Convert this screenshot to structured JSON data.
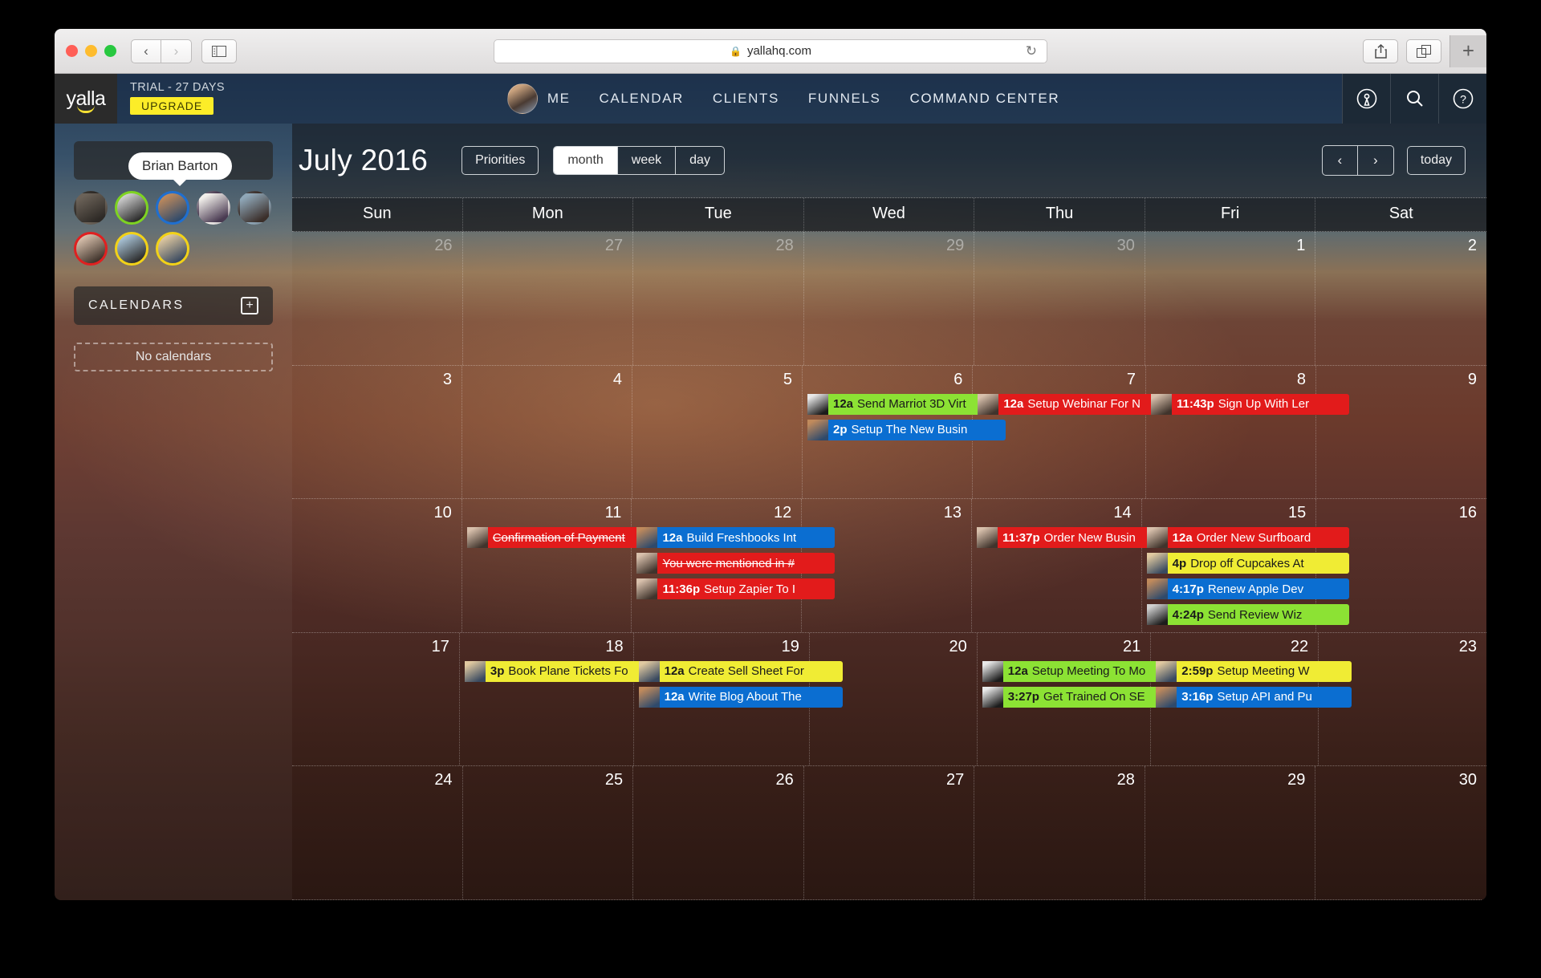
{
  "browser": {
    "url": "yallahq.com",
    "lock_icon": "lock-icon",
    "back_icon": "‹",
    "forward_icon": "›",
    "reload_icon": "↻",
    "newtab_label": "+"
  },
  "topnav": {
    "logo": "yalla",
    "trial_label": "TRIAL - 27 DAYS",
    "upgrade_label": "UPGRADE",
    "links": [
      {
        "label": "ME"
      },
      {
        "label": "CALENDAR"
      },
      {
        "label": "CLIENTS"
      },
      {
        "label": "FUNNELS"
      },
      {
        "label": "COMMAND CENTER"
      }
    ],
    "icons": [
      "broadcast-icon",
      "search-icon",
      "help-icon"
    ]
  },
  "sidebar": {
    "tooltip_name": "Brian Barton",
    "calendars_label": "CALENDARS",
    "add_calendar_icon": "plus-icon",
    "no_calendars_label": "No calendars",
    "avatars": [
      {
        "ring": "none",
        "c1": "#6b6258",
        "c2": "#2e2a26"
      },
      {
        "ring": "#7ed321",
        "c1": "#cfcfcf",
        "c2": "#2b2b2b"
      },
      {
        "ring": "#1f6fd0",
        "c1": "#c08a5c",
        "c2": "#2f4a6b"
      },
      {
        "ring": "none",
        "c1": "#f1eeea",
        "c2": "#4a3b52"
      },
      {
        "ring": "none",
        "c1": "#8fa7b8",
        "c2": "#3b2f2a"
      },
      {
        "ring": "#e02020",
        "c1": "#d8c0ac",
        "c2": "#40342c"
      },
      {
        "ring": "#f2d218",
        "c1": "#a9c3d6",
        "c2": "#2c2c2c"
      },
      {
        "ring": "#f2d218",
        "c1": "#e0c9a0",
        "c2": "#3a4a60"
      }
    ]
  },
  "calendar": {
    "title": "July 2016",
    "priorities_label": "Priorities",
    "views": [
      {
        "label": "month",
        "active": true
      },
      {
        "label": "week",
        "active": false
      },
      {
        "label": "day",
        "active": false
      }
    ],
    "prev_label": "‹",
    "next_label": "›",
    "today_label": "today",
    "daynames": [
      "Sun",
      "Mon",
      "Tue",
      "Wed",
      "Thu",
      "Fri",
      "Sat"
    ],
    "weeks": [
      {
        "days": [
          {
            "num": "26",
            "other": true,
            "events": []
          },
          {
            "num": "27",
            "other": true,
            "events": []
          },
          {
            "num": "28",
            "other": true,
            "events": []
          },
          {
            "num": "29",
            "other": true,
            "events": []
          },
          {
            "num": "30",
            "other": true,
            "events": []
          },
          {
            "num": "1",
            "other": false,
            "events": []
          },
          {
            "num": "2",
            "other": false,
            "events": []
          }
        ]
      },
      {
        "days": [
          {
            "num": "3",
            "other": false,
            "events": []
          },
          {
            "num": "4",
            "other": false,
            "events": []
          },
          {
            "num": "5",
            "other": false,
            "events": []
          },
          {
            "num": "6",
            "other": false,
            "events": [
              {
                "time": "12a",
                "title": "Send Marriot 3D Virt",
                "color": "#8ce234",
                "text": "#1a1a1a",
                "strike": false,
                "c1": "#e8e8e8",
                "c2": "#1c1c1c"
              },
              {
                "time": "2p",
                "title": "Setup The New Busin",
                "color": "#0b6ed1",
                "text": "#ffffff",
                "strike": false,
                "c1": "#c08a5c",
                "c2": "#2f4a6b"
              }
            ]
          },
          {
            "num": "7",
            "other": false,
            "events": [
              {
                "time": "12a",
                "title": "Setup Webinar For N",
                "color": "#e21b1b",
                "text": "#ffffff",
                "strike": false,
                "c1": "#d8c0ac",
                "c2": "#40342c"
              }
            ]
          },
          {
            "num": "8",
            "other": false,
            "events": [
              {
                "time": "11:43p",
                "title": "Sign Up With Ler",
                "color": "#e21b1b",
                "text": "#ffffff",
                "strike": false,
                "c1": "#d8c0ac",
                "c2": "#40342c"
              }
            ]
          },
          {
            "num": "9",
            "other": false,
            "events": []
          }
        ]
      },
      {
        "days": [
          {
            "num": "10",
            "other": false,
            "events": []
          },
          {
            "num": "11",
            "other": false,
            "events": [
              {
                "time": "",
                "title": "Confirmation of Payment",
                "color": "#e21b1b",
                "text": "#ffffff",
                "strike": true,
                "c1": "#d8c0ac",
                "c2": "#40342c"
              }
            ]
          },
          {
            "num": "12",
            "other": false,
            "events": [
              {
                "time": "12a",
                "title": "Build Freshbooks Int",
                "color": "#0b6ed1",
                "text": "#ffffff",
                "strike": false,
                "c1": "#c08a5c",
                "c2": "#2f4a6b"
              },
              {
                "time": "",
                "title": "You were mentioned in #",
                "color": "#e21b1b",
                "text": "#ffffff",
                "strike": true,
                "c1": "#d8c0ac",
                "c2": "#40342c"
              },
              {
                "time": "11:36p",
                "title": "Setup Zapier To I",
                "color": "#e21b1b",
                "text": "#ffffff",
                "strike": false,
                "c1": "#d8c0ac",
                "c2": "#40342c"
              }
            ]
          },
          {
            "num": "13",
            "other": false,
            "events": []
          },
          {
            "num": "14",
            "other": false,
            "events": [
              {
                "time": "11:37p",
                "title": "Order New Busin",
                "color": "#e21b1b",
                "text": "#ffffff",
                "strike": false,
                "c1": "#d8c0ac",
                "c2": "#40342c"
              }
            ]
          },
          {
            "num": "15",
            "other": false,
            "events": [
              {
                "time": "12a",
                "title": "Order New Surfboard",
                "color": "#e21b1b",
                "text": "#ffffff",
                "strike": false,
                "c1": "#d8c0ac",
                "c2": "#40342c"
              },
              {
                "time": "4p",
                "title": "Drop off Cupcakes At",
                "color": "#f0ec34",
                "text": "#1a1a1a",
                "strike": false,
                "c1": "#e0c9a0",
                "c2": "#3a4a60"
              },
              {
                "time": "4:17p",
                "title": "Renew Apple Dev",
                "color": "#0b6ed1",
                "text": "#ffffff",
                "strike": false,
                "c1": "#c08a5c",
                "c2": "#2f4a6b"
              },
              {
                "time": "4:24p",
                "title": "Send Review Wiz",
                "color": "#8ce234",
                "text": "#1a1a1a",
                "strike": false,
                "c1": "#d0d0d0",
                "c2": "#1c1c1c"
              }
            ]
          },
          {
            "num": "16",
            "other": false,
            "events": []
          }
        ]
      },
      {
        "days": [
          {
            "num": "17",
            "other": false,
            "events": []
          },
          {
            "num": "18",
            "other": false,
            "events": [
              {
                "time": "3p",
                "title": "Book Plane Tickets Fo",
                "color": "#f0ec34",
                "text": "#1a1a1a",
                "strike": false,
                "c1": "#e0c9a0",
                "c2": "#3a4a60"
              }
            ]
          },
          {
            "num": "19",
            "other": false,
            "events": [
              {
                "time": "12a",
                "title": "Create Sell Sheet For",
                "color": "#f0ec34",
                "text": "#1a1a1a",
                "strike": false,
                "c1": "#e0c9a0",
                "c2": "#3a4a60"
              },
              {
                "time": "12a",
                "title": "Write Blog About The",
                "color": "#0b6ed1",
                "text": "#ffffff",
                "strike": false,
                "c1": "#c08a5c",
                "c2": "#2f4a6b"
              }
            ]
          },
          {
            "num": "20",
            "other": false,
            "events": []
          },
          {
            "num": "21",
            "other": false,
            "events": [
              {
                "time": "12a",
                "title": "Setup Meeting To Mo",
                "color": "#8ce234",
                "text": "#1a1a1a",
                "strike": false,
                "c1": "#e8e8e8",
                "c2": "#1c1c1c"
              },
              {
                "time": "3:27p",
                "title": "Get Trained On SE",
                "color": "#8ce234",
                "text": "#1a1a1a",
                "strike": false,
                "c1": "#e8e8e8",
                "c2": "#1c1c1c"
              }
            ]
          },
          {
            "num": "22",
            "other": false,
            "events": [
              {
                "time": "2:59p",
                "title": "Setup Meeting W",
                "color": "#f0ec34",
                "text": "#1a1a1a",
                "strike": false,
                "c1": "#e0c9a0",
                "c2": "#3a4a60"
              },
              {
                "time": "3:16p",
                "title": "Setup API and Pu",
                "color": "#0b6ed1",
                "text": "#ffffff",
                "strike": false,
                "c1": "#c08a5c",
                "c2": "#2f4a6b"
              }
            ]
          },
          {
            "num": "23",
            "other": false,
            "events": []
          }
        ]
      },
      {
        "days": [
          {
            "num": "24",
            "other": false,
            "events": []
          },
          {
            "num": "25",
            "other": false,
            "events": []
          },
          {
            "num": "26",
            "other": false,
            "events": []
          },
          {
            "num": "27",
            "other": false,
            "events": []
          },
          {
            "num": "28",
            "other": false,
            "events": []
          },
          {
            "num": "29",
            "other": false,
            "events": []
          },
          {
            "num": "30",
            "other": false,
            "events": []
          }
        ]
      }
    ]
  }
}
